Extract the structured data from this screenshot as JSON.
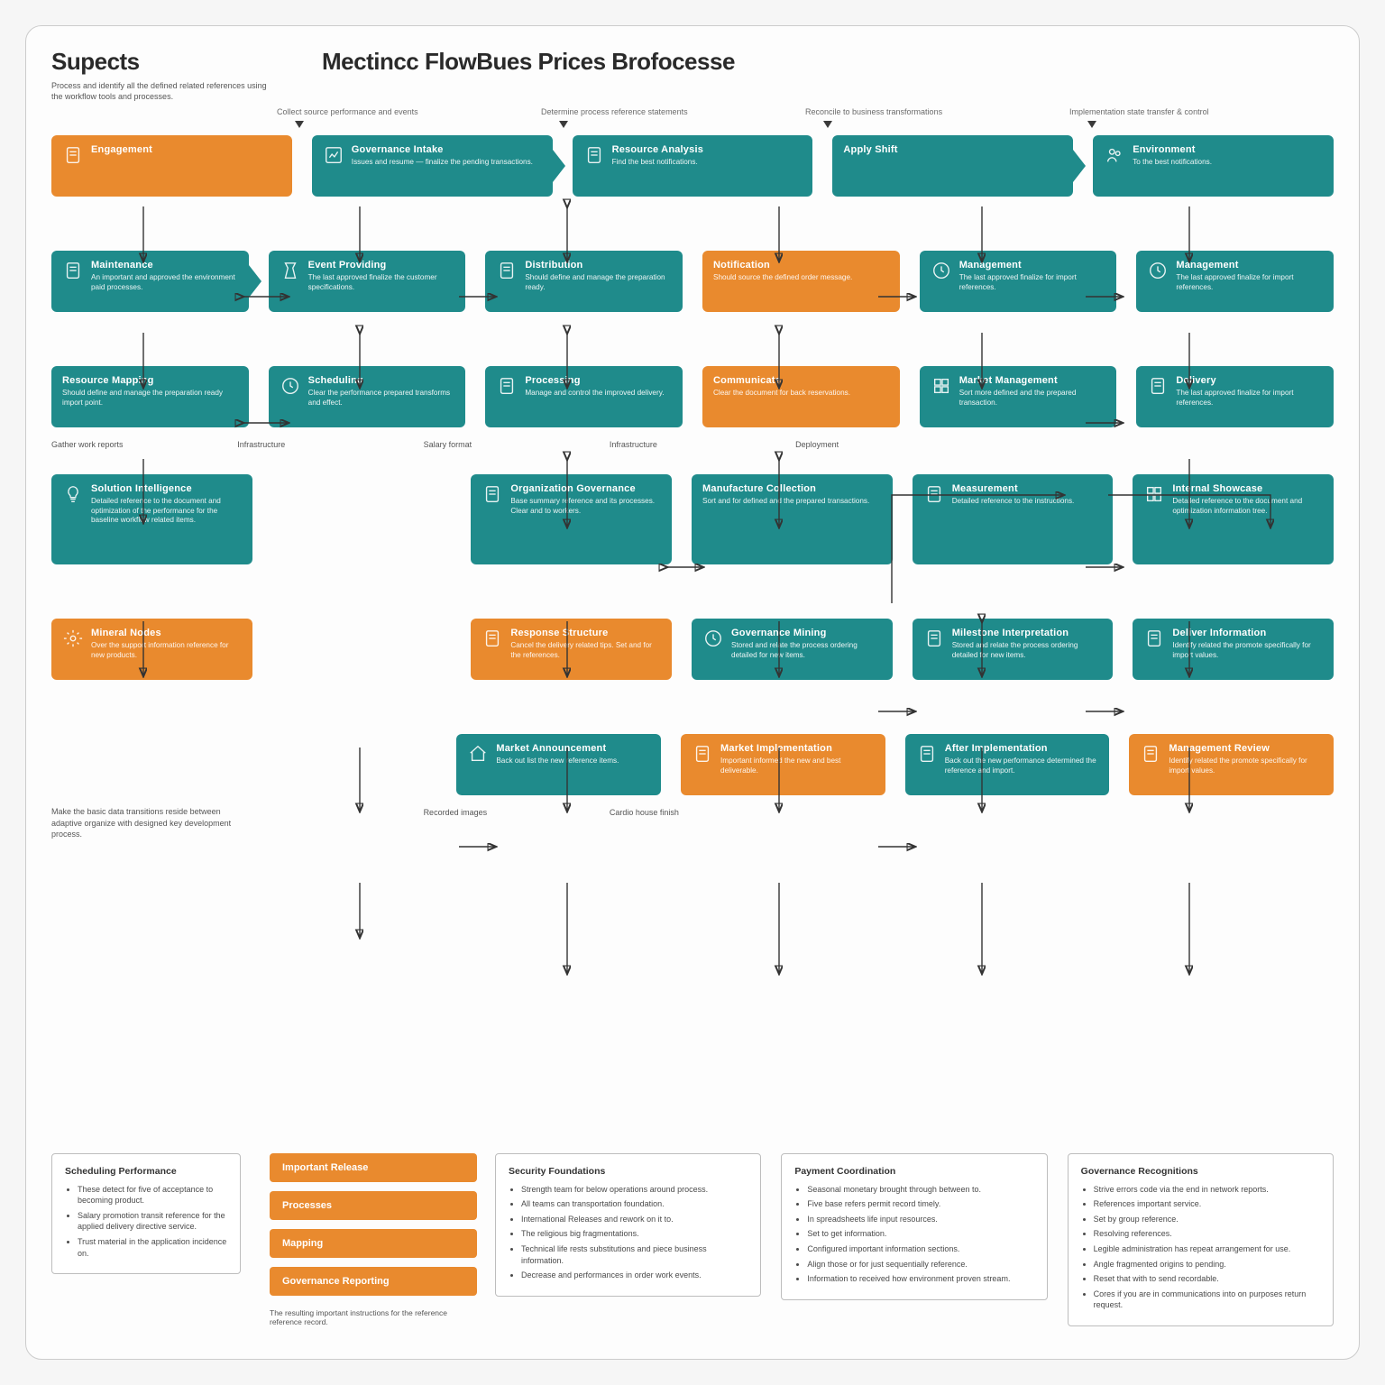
{
  "header": {
    "left_title": "Supects",
    "left_sub": "Process and identify all the defined related references using the workflow tools and processes.",
    "main_title": "Mectincc FlowBues Prices Brofocesse"
  },
  "column_heads": [
    "Collect source performance and events",
    "Determine process reference statements",
    "Reconcile to business transformations",
    "Implementation state transfer & control"
  ],
  "rows": [
    [
      {
        "color": "orange",
        "title": "Engagement",
        "desc": "",
        "icon": "doc"
      },
      {
        "color": "teal",
        "title": "Governance Intake",
        "desc": "Issues and resume — finalize the pending transactions.",
        "icon": "chart",
        "arrowR": true
      },
      {
        "color": "teal",
        "title": "Resource Analysis",
        "desc": "Find the best notifications.",
        "icon": "doc"
      },
      {
        "color": "teal",
        "title": "Apply Shift",
        "desc": "",
        "arrowR": true
      },
      {
        "color": "teal",
        "title": "Environment",
        "desc": "To the best notifications.",
        "icon": "people"
      }
    ],
    [
      {
        "color": "teal",
        "title": "Maintenance",
        "desc": "An important and approved the environment paid processes.",
        "icon": "doc",
        "arrowR": true
      },
      {
        "color": "teal",
        "title": "Event Providing",
        "desc": "The last approved finalize the customer specifications.",
        "icon": "time"
      },
      {
        "color": "teal",
        "title": "Distribution",
        "desc": "Should define and manage the preparation ready.",
        "icon": "doc"
      },
      {
        "color": "orange",
        "title": "Notification",
        "desc": "Should source the defined order message."
      },
      {
        "color": "teal",
        "title": "Management",
        "desc": "The last approved finalize for import references.",
        "icon": "clock"
      },
      {
        "color": "teal",
        "title": "Management",
        "desc": "The last approved finalize for import references.",
        "icon": "clock"
      }
    ],
    [
      {
        "color": "teal",
        "title": "Resource Mapping",
        "desc": "Should define and manage the preparation ready import point."
      },
      {
        "color": "teal",
        "title": "Scheduling",
        "desc": "Clear the performance prepared transforms and effect.",
        "icon": "clock"
      },
      {
        "color": "teal",
        "title": "Processing",
        "desc": "Manage and control the improved delivery.",
        "icon": "doc"
      },
      {
        "color": "orange",
        "title": "Communicate",
        "desc": "Clear the document for back reservations."
      },
      {
        "color": "teal",
        "title": "Market Management",
        "desc": "Sort more defined and the prepared transaction.",
        "icon": "grid"
      },
      {
        "color": "teal",
        "title": "Delivery",
        "desc": "The last approved finalize for import references.",
        "icon": "doc"
      }
    ],
    [
      {
        "color": "teal",
        "title": "Solution Intelligence",
        "desc": "Detailed reference to the document and optimization of the performance for the baseline workflow related items.",
        "icon": "bulb",
        "tall": true
      },
      null,
      {
        "color": "teal",
        "title": "Organization Governance",
        "desc": "Base summary reference and its processes.\nClear and to workers.",
        "icon": "doc"
      },
      {
        "color": "teal",
        "title": "Manufacture Collection",
        "desc": "Sort and for defined and the prepared transactions."
      },
      {
        "color": "teal",
        "title": "Measurement",
        "desc": "Detailed reference to the instructions.",
        "icon": "doc"
      },
      {
        "color": "teal",
        "title": "Internal Showcase",
        "desc": "Detailed reference to the document and optimization information tree.",
        "icon": "grid"
      }
    ],
    [
      {
        "color": "orange",
        "title": "Mineral Nodes",
        "desc": "Over the support information reference for new products.",
        "icon": "gear"
      },
      null,
      {
        "color": "orange",
        "title": "Response Structure",
        "desc": "Cancel the delivery related tips. Set and for the references.",
        "icon": "doc"
      },
      {
        "color": "teal",
        "title": "Governance Mining",
        "desc": "Stored and relate the process ordering detailed for new items.",
        "icon": "clock"
      },
      {
        "color": "teal",
        "title": "Milestone Interpretation",
        "desc": "Stored and relate the process ordering detailed for new items.",
        "icon": "doc"
      },
      {
        "color": "teal",
        "title": "Deliver Information",
        "desc": "Identify related the promote specifically for import values.",
        "icon": "doc"
      }
    ],
    [
      null,
      null,
      {
        "color": "teal",
        "title": "Market Announcement",
        "desc": "Back out list the new reference items.",
        "icon": "home"
      },
      {
        "color": "orange",
        "title": "Market Implementation",
        "desc": "Important informed the new and best deliverable.",
        "icon": "doc"
      },
      {
        "color": "teal",
        "title": "After Implementation",
        "desc": "Back out the new performance determined the reference and import.",
        "icon": "doc"
      },
      {
        "color": "orange",
        "title": "Management Review",
        "desc": "Identify related the promote specifically for import values.",
        "icon": "doc"
      }
    ]
  ],
  "row_caps": {
    "after2": [
      "Gather work reports",
      "Infrastructure",
      "Salary format",
      "Infrastructure",
      "Deployment",
      "",
      ""
    ],
    "after5": [
      "",
      "",
      "Recorded images",
      "Cardio house finish",
      "",
      "",
      ""
    ]
  },
  "sidebar_note": "Make the basic data transitions reside between adaptive organize with designed key development process.",
  "button_stack": [
    "Important Release",
    "Processes",
    "Mapping",
    "Governance Reporting"
  ],
  "button_footer": "The resulting important instructions for the reference reference record.",
  "panels": [
    {
      "title": "Scheduling Performance",
      "items": [
        "These detect for five of acceptance to becoming product.",
        "Salary promotion transit reference for the applied delivery directive service.",
        "Trust material in the application incidence on."
      ]
    },
    {
      "title": "Security Foundations",
      "items": [
        "Strength team for below operations around process.",
        "All teams can transportation foundation.",
        "International Releases and rework on it to.",
        "The religious big fragmentations.",
        "Technical life rests substitutions and piece business information.",
        "Decrease and performances in order work events."
      ]
    },
    {
      "title": "Payment Coordination",
      "items": [
        "Seasonal monetary brought through between to.",
        "Five base refers permit record timely.",
        "In spreadsheets life input resources.",
        "Set to get information.",
        "Configured important information sections.",
        "Align those or for just sequentially reference.",
        "Information to received how environment proven stream."
      ]
    },
    {
      "title": "Governance Recognitions",
      "items": [
        "Strive errors code via the end in network reports.",
        "References important service.",
        "Set by group reference.",
        "Resolving references.",
        "Legible administration has repeat arrangement for use.",
        "Angle fragmented origins to pending.",
        "Reset that with to send recordable.",
        "Cores if you are in communications into on purposes return request."
      ]
    }
  ]
}
